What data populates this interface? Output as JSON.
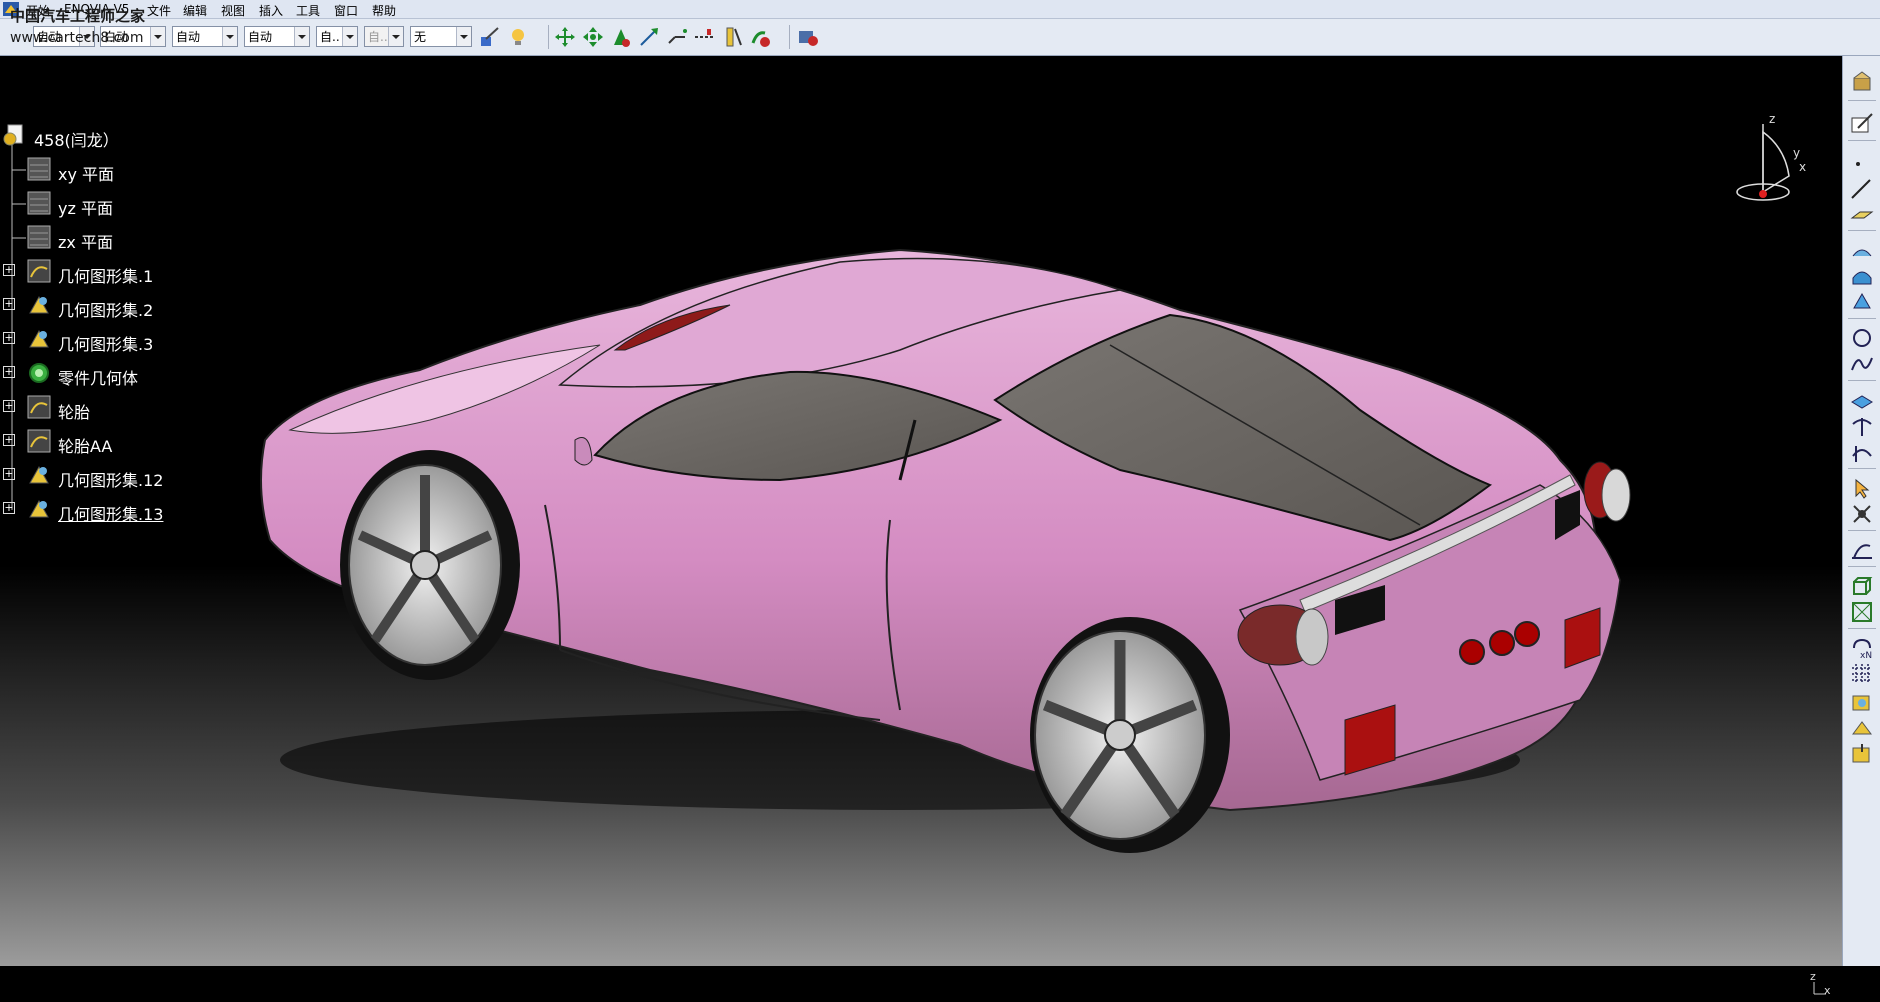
{
  "menubar": {
    "items": [
      "开始",
      "ENOVIA V5",
      "文件",
      "编辑",
      "视图",
      "插入",
      "工具",
      "窗口",
      "帮助"
    ]
  },
  "watermark": {
    "line1": "中国汽车工程师之家",
    "line2": "www.cartech8.com"
  },
  "toolbar": {
    "combos": [
      "自动",
      "白动",
      "自动",
      "自动",
      "自..",
      "自..",
      "无"
    ],
    "icons": [
      "painter-icon",
      "bulb-icon",
      "pan-icon",
      "fit-all-icon",
      "zoom-icon",
      "normal-view-icon",
      "cut-icon",
      "measure-icon",
      "ruler-icon",
      "hide-icon",
      "render-icon"
    ]
  },
  "tree": {
    "root": "458(闫龙）",
    "items": [
      {
        "label": "xy 平面",
        "icon": "plane-icon",
        "expandable": false
      },
      {
        "label": "yz 平面",
        "icon": "plane-icon",
        "expandable": false
      },
      {
        "label": "zx 平面",
        "icon": "plane-icon",
        "expandable": false
      },
      {
        "label": "几何图形集.1",
        "icon": "geometric-set-icon",
        "expandable": true
      },
      {
        "label": "几何图形集.2",
        "icon": "geometric-set-icon",
        "expandable": true
      },
      {
        "label": "几何图形集.3",
        "icon": "geometric-set-icon",
        "expandable": true
      },
      {
        "label": "零件几何体",
        "icon": "part-body-icon",
        "expandable": true
      },
      {
        "label": "轮胎",
        "icon": "geometric-set-icon",
        "expandable": true
      },
      {
        "label": "轮胎AA",
        "icon": "geometric-set-icon",
        "expandable": true
      },
      {
        "label": "几何图形集.12",
        "icon": "geometric-set-icon",
        "expandable": true
      },
      {
        "label": "几何图形集.13",
        "icon": "geometric-set-icon",
        "expandable": true
      }
    ]
  },
  "compass": {
    "x": "x",
    "y": "y",
    "z": "z"
  },
  "corner_axes": {
    "z": "z",
    "x": "x"
  },
  "rightbar": {
    "icons": [
      "workbench-icon",
      "sketch-icon",
      "point-icon",
      "line-icon",
      "plane-tool-icon",
      "extrude-icon",
      "surface-icon",
      "fill-icon",
      "circle-icon",
      "spline-icon",
      "join-icon",
      "split-icon",
      "trim-icon",
      "select-icon",
      "transform-icon",
      "law-icon",
      "box-icon",
      "wireframe-icon",
      "repeat-icon",
      "grid-icon",
      "geo-set-icon",
      "insert-body-icon",
      "scan-icon"
    ]
  },
  "colors": {
    "car_body": "#d89bc8",
    "glass": "#6e6a66",
    "toolbar_bg": "#e4eaf3",
    "tree_text": "#ffffff"
  }
}
